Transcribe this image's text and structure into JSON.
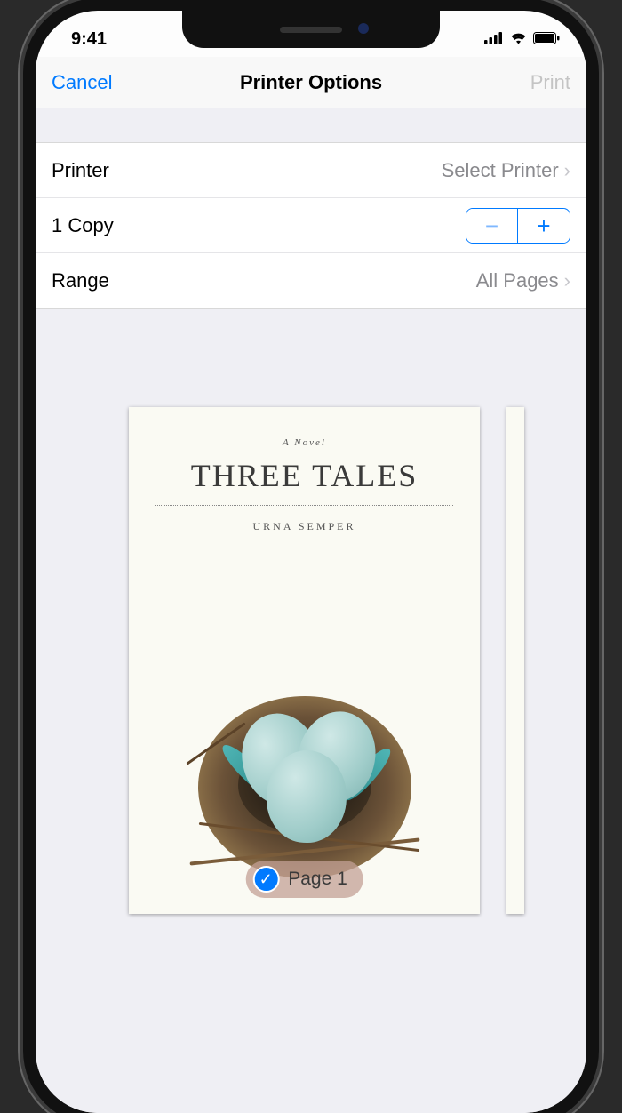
{
  "status": {
    "time": "9:41"
  },
  "nav": {
    "cancel": "Cancel",
    "title": "Printer Options",
    "print": "Print"
  },
  "rows": {
    "printer_label": "Printer",
    "printer_value": "Select Printer",
    "copies_label": "1 Copy",
    "range_label": "Range",
    "range_value": "All Pages"
  },
  "preview": {
    "page_pill": "Page 1",
    "cover": {
      "subtitle": "A Novel",
      "title": "THREE TALES",
      "author": "URNA SEMPER"
    }
  }
}
